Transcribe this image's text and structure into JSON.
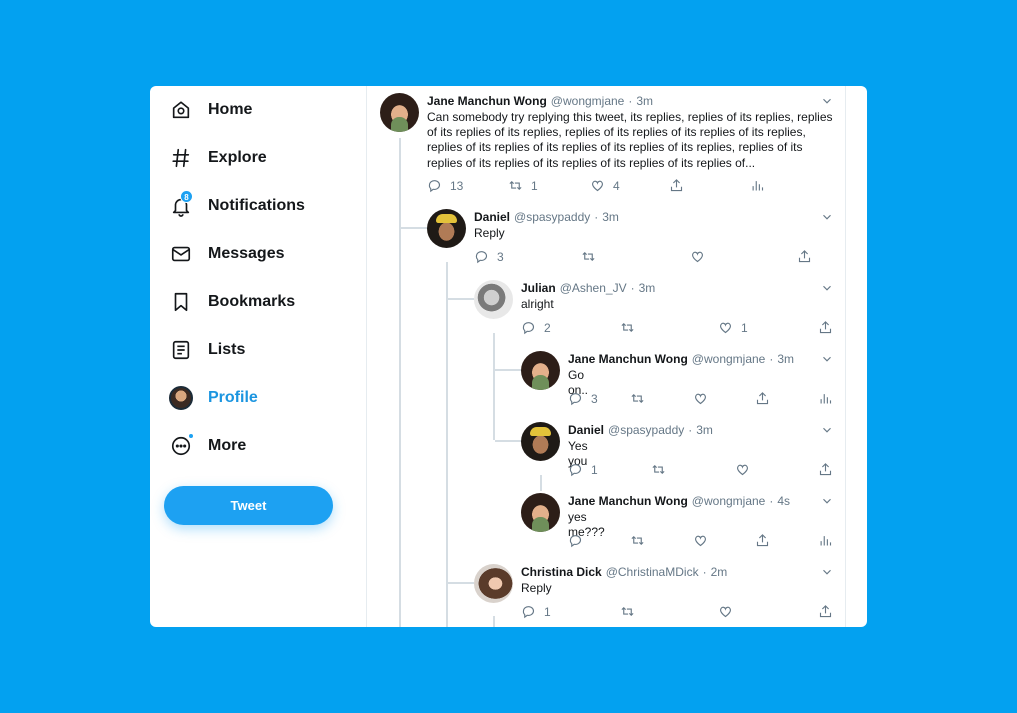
{
  "nav": {
    "home": "Home",
    "explore": "Explore",
    "notifications": "Notifications",
    "notifications_badge": "8",
    "messages": "Messages",
    "bookmarks": "Bookmarks",
    "lists": "Lists",
    "profile": "Profile",
    "more": "More",
    "tweet_button": "Tweet"
  },
  "tweets": [
    {
      "name": "Jane Manchun Wong",
      "handle": "@wongmjane",
      "time": "3m",
      "text": "Can somebody try replying this tweet, its replies, replies of its replies, replies of its replies of its replies, replies of its replies of its replies of its replies, replies of its replies of its replies of its replies of its replies, replies of its replies of its replies of its replies of its replies of its replies of...",
      "reply_count": "13",
      "retweet_count": "1",
      "like_count": "4"
    },
    {
      "name": "Daniel",
      "handle": "@spasypaddy",
      "time": "3m",
      "text": "Reply",
      "reply_count": "3"
    },
    {
      "name": "Julian",
      "handle": "@Ashen_JV",
      "time": "3m",
      "text": "alright",
      "reply_count": "2",
      "like_count": "1"
    },
    {
      "name": "Jane Manchun Wong",
      "handle": "@wongmjane",
      "time": "3m",
      "text": "Go on..",
      "reply_count": "3"
    },
    {
      "name": "Daniel",
      "handle": "@spasypaddy",
      "time": "3m",
      "text": "Yes you",
      "reply_count": "1"
    },
    {
      "name": "Jane Manchun Wong",
      "handle": "@wongmjane",
      "time": "4s",
      "text": "yes me???"
    },
    {
      "name": "Christina Dick",
      "handle": "@ChristinaMDick",
      "time": "2m",
      "text": "Reply",
      "reply_count": "1"
    }
  ],
  "separator": "·",
  "colors": {
    "background": "#03a1f0",
    "accent": "#1da1f2",
    "text": "#14171a",
    "muted": "#657786"
  }
}
